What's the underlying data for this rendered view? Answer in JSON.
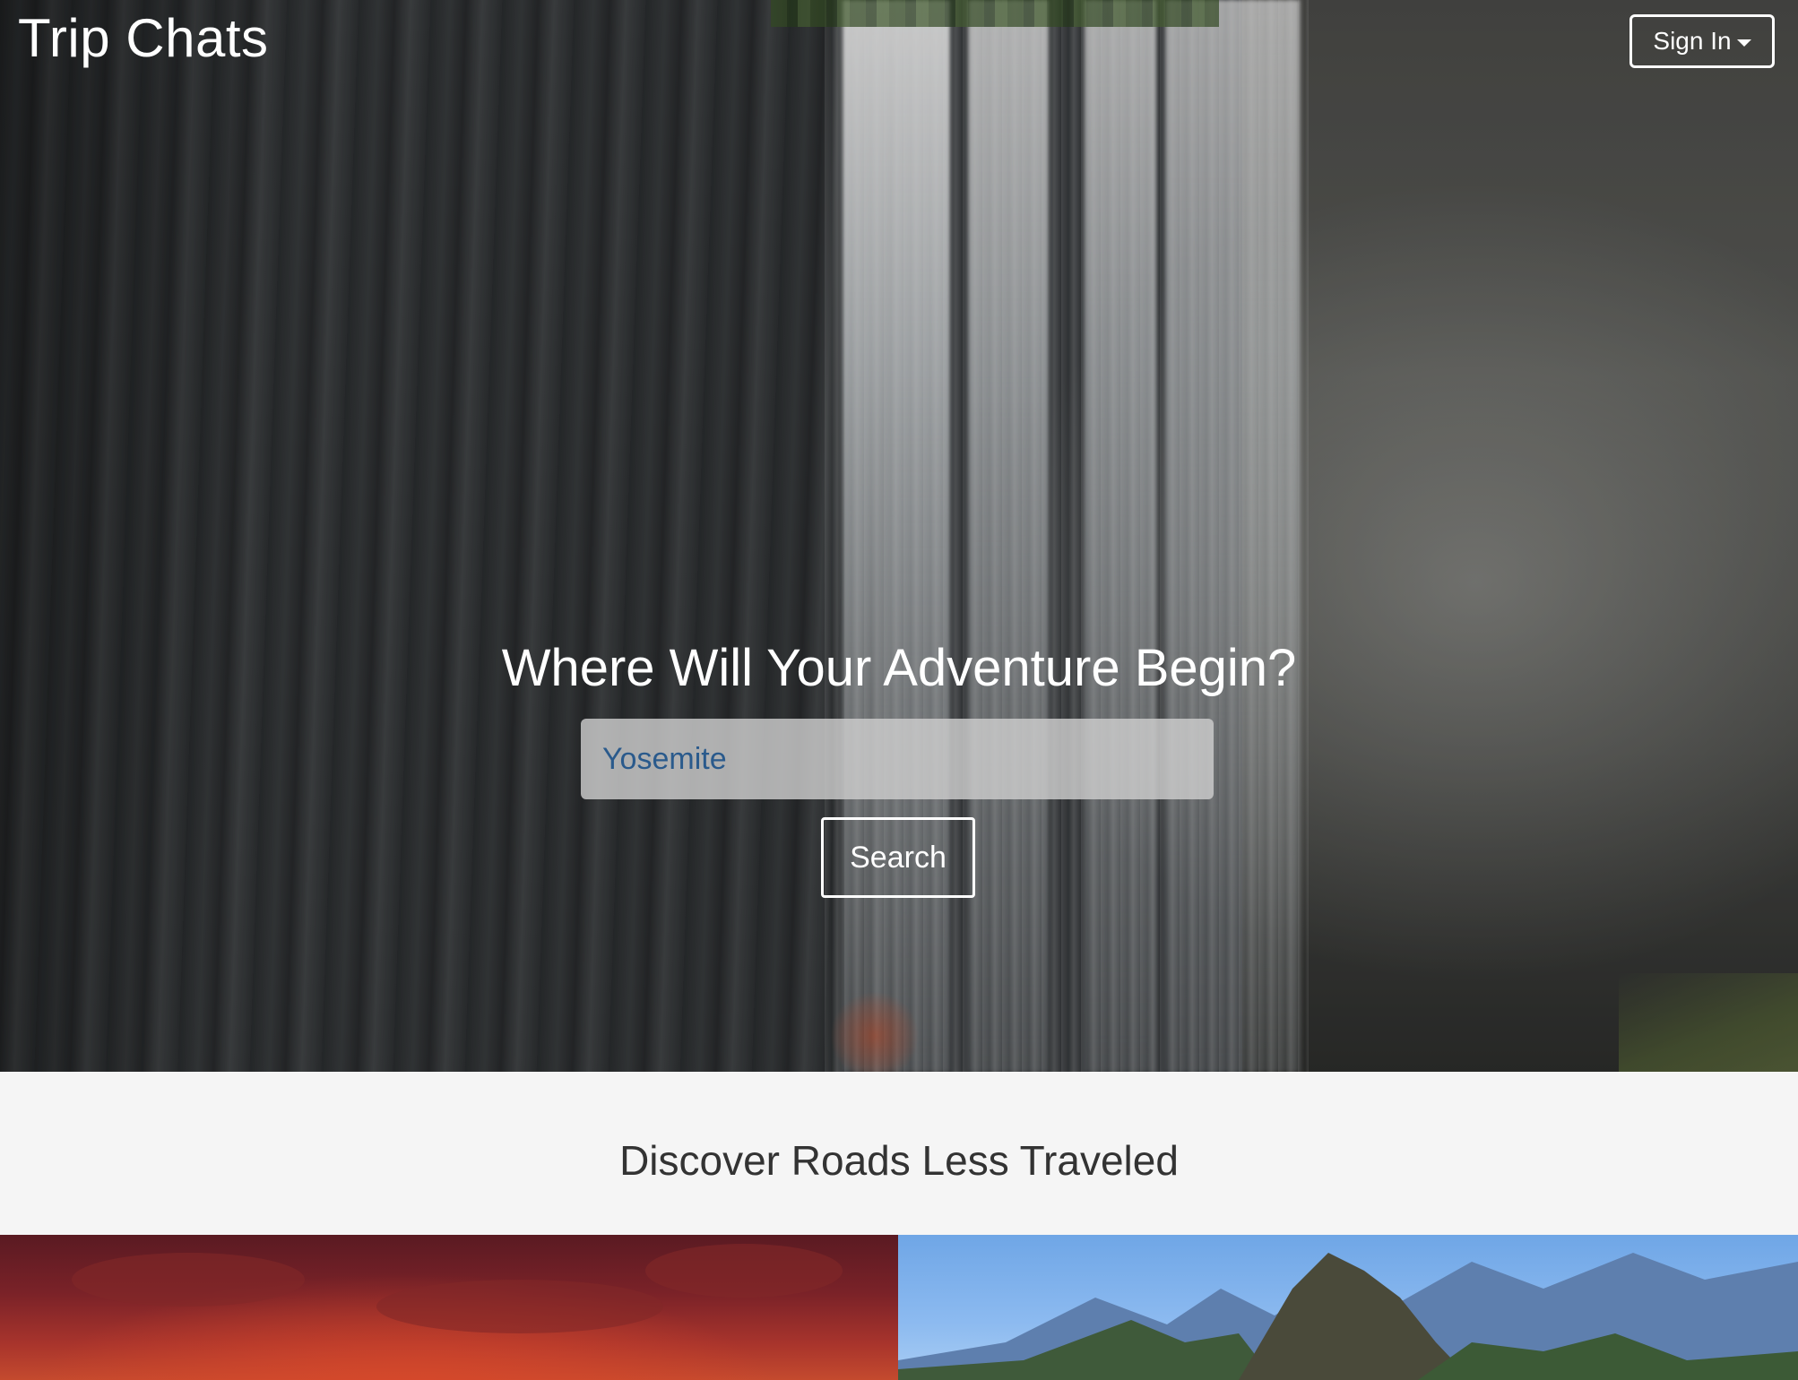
{
  "header": {
    "brand": "Trip Chats",
    "signin_label": "Sign In"
  },
  "hero": {
    "title": "Where Will Your Adventure Begin?",
    "search": {
      "value": "Yosemite",
      "placeholder": "Yosemite"
    },
    "search_button_label": "Search"
  },
  "discover": {
    "title": "Discover Roads Less Traveled"
  },
  "icons": {
    "signin_caret": "caret-down-icon"
  },
  "colors": {
    "accent_text": "#2a5a8c",
    "section_bg": "#f5f5f5",
    "heading_text": "#333333"
  }
}
